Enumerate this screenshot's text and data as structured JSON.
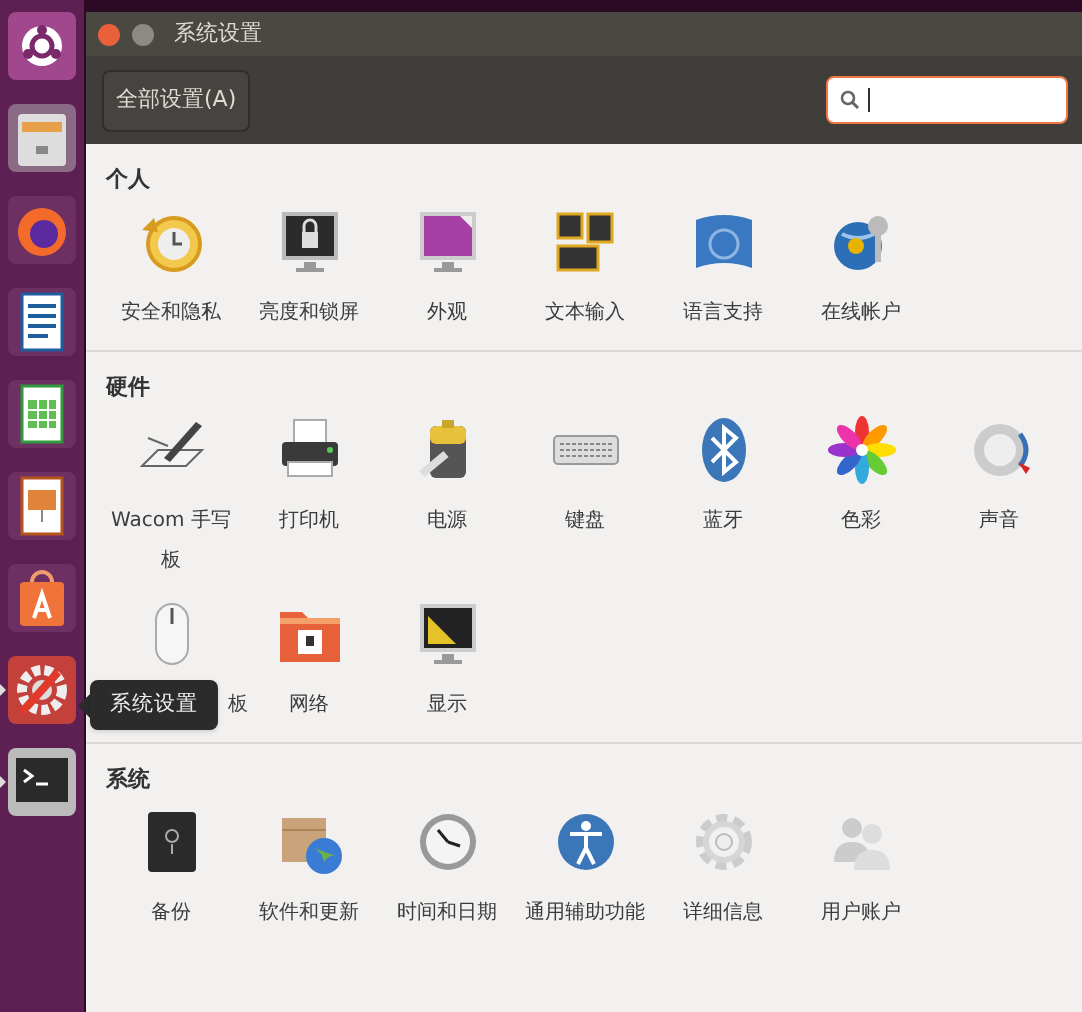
{
  "launcher": [
    {
      "running": false
    },
    {
      "running": false
    },
    {
      "running": false
    },
    {
      "running": false
    },
    {
      "running": false
    },
    {
      "running": false
    },
    {
      "running": false
    },
    {
      "running": true
    },
    {
      "running": true
    }
  ],
  "tooltip": {
    "text": "系统设置"
  },
  "window": {
    "title": "系统设置"
  },
  "toolbar": {
    "all_settings": "全部设置(A)",
    "search": {
      "focused": true
    }
  },
  "sections": [
    {
      "title": "个人",
      "items": [
        {
          "label": "安全和隐私"
        },
        {
          "label": "亮度和锁屏"
        },
        {
          "label": "外观"
        },
        {
          "label": "文本输入"
        },
        {
          "label": "语言支持"
        },
        {
          "label": "在线帐户"
        }
      ]
    },
    {
      "title": "硬件",
      "items": [
        {
          "label": "Wacom 手写板"
        },
        {
          "label": "打印机"
        },
        {
          "label": "电源"
        },
        {
          "label": "键盘"
        },
        {
          "label": "蓝牙"
        },
        {
          "label": "色彩"
        },
        {
          "label": "声音"
        },
        {
          "label": "板"
        },
        {
          "label": "网络"
        },
        {
          "label": "显示"
        }
      ]
    },
    {
      "title": "系统",
      "items": [
        {
          "label": "备份"
        },
        {
          "label": "软件和更新"
        },
        {
          "label": "时间和日期"
        },
        {
          "label": "通用辅助功能"
        },
        {
          "label": "详细信息"
        },
        {
          "label": "用户账户"
        }
      ]
    }
  ]
}
